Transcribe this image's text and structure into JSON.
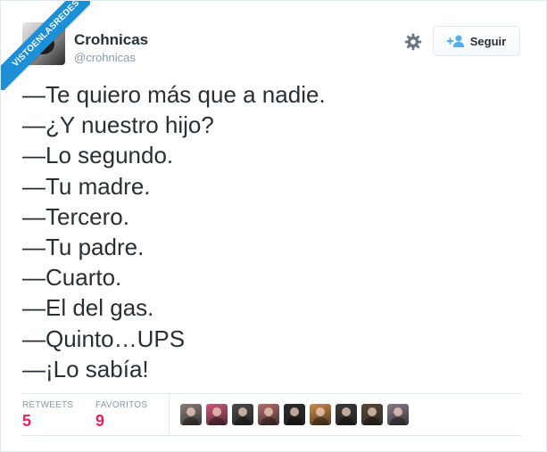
{
  "watermark": {
    "text": "VISTOENLASREDES"
  },
  "author": {
    "name": "Crohnicas",
    "handle": "@crohnicas"
  },
  "actions": {
    "follow_label": "Seguir"
  },
  "tweet": {
    "lines": [
      "—Te quiero más que a nadie.",
      "—¿Y nuestro hijo?",
      "—Lo segundo.",
      "—Tu madre.",
      "—Tercero.",
      "—Tu padre.",
      "—Cuarto.",
      "—El del gas.",
      "—Quinto…UPS",
      "—¡Lo sabía!"
    ]
  },
  "stats": {
    "retweets_label": "RETWEETS",
    "retweets_value": "5",
    "favorites_label": "FAVORITOS",
    "favorites_value": "9"
  },
  "colors": {
    "accent": "#e0245e",
    "text": "#292f33",
    "muted": "#8899a6",
    "ribbon": "#1c8fd6"
  },
  "facepile": [
    {
      "icon": "user-avatar-1",
      "bg": "#8a7f7a"
    },
    {
      "icon": "user-avatar-2",
      "bg": "#d4587a"
    },
    {
      "icon": "user-avatar-3",
      "bg": "#4a4a4a"
    },
    {
      "icon": "user-avatar-4",
      "bg": "#b56b6b"
    },
    {
      "icon": "user-avatar-5",
      "bg": "#2b2b2b"
    },
    {
      "icon": "user-avatar-6",
      "bg": "#d08a45"
    },
    {
      "icon": "user-avatar-7",
      "bg": "#3c3a38"
    },
    {
      "icon": "user-avatar-8",
      "bg": "#5a4a3a"
    },
    {
      "icon": "user-avatar-9",
      "bg": "#8a7a8a"
    }
  ]
}
